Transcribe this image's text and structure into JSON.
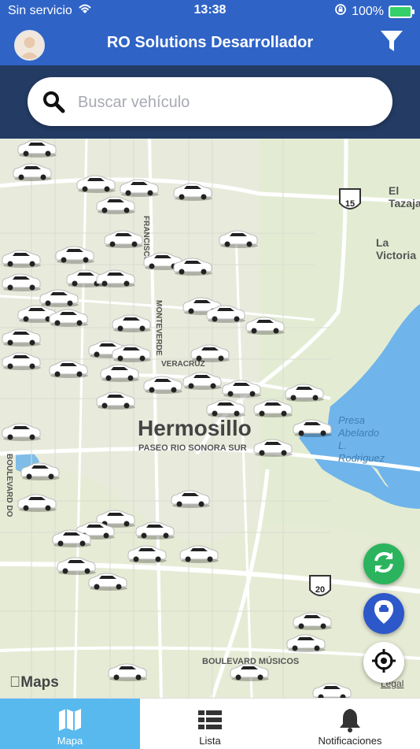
{
  "status_bar": {
    "carrier": "Sin servicio",
    "time": "13:38",
    "battery": "100%"
  },
  "header": {
    "title": "RO Solutions Desarrollador"
  },
  "search": {
    "placeholder": "Buscar vehículo"
  },
  "map": {
    "city": "Hermosillo",
    "lake": "Presa\nAbelardo\nL.\nRodriguez",
    "labels": [
      {
        "text": "El Tazajal",
        "name": "place-el-tazajal"
      },
      {
        "text": "La Victoria",
        "name": "place-la-victoria"
      },
      {
        "text": "FRANCISCO",
        "name": "street-francisco"
      },
      {
        "text": "MONTEVERDE",
        "name": "street-monteverde"
      },
      {
        "text": "VERACRUZ",
        "name": "street-veracruz"
      },
      {
        "text": "PASEO RIO SONORA SUR",
        "name": "street-paseo-rio-sonora"
      },
      {
        "text": "BOULEVARD DO",
        "name": "street-boulevard-do"
      },
      {
        "text": "BOULEVARD MÚSICOS",
        "name": "street-boulevard-musicos"
      }
    ],
    "shields": [
      "15",
      "20"
    ],
    "brand": "Maps",
    "legal": "Legal"
  },
  "tabs": [
    {
      "label": "Mapa"
    },
    {
      "label": "Lista"
    },
    {
      "label": "Notificaciones"
    }
  ]
}
